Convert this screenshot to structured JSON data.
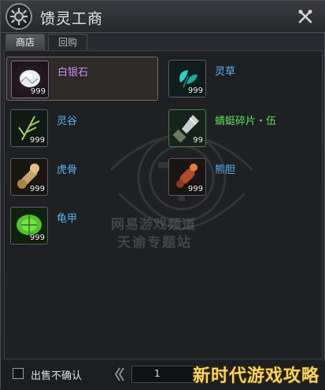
{
  "window": {
    "title": "馈灵工商"
  },
  "tabs": [
    {
      "label": "商店",
      "active": true
    },
    {
      "label": "回购",
      "active": false
    }
  ],
  "items": [
    {
      "name": "白银石",
      "qty": "999",
      "color": "#c98df2",
      "icon": "silver-stone-icon"
    },
    {
      "name": "灵草",
      "qty": "999",
      "color": "#58b0f0",
      "icon": "spirit-herb-icon"
    },
    {
      "name": "灵谷",
      "qty": "999",
      "color": "#58b0f0",
      "icon": "spirit-grain-icon"
    },
    {
      "name": "蜻蜓碎片・伍",
      "qty": "99",
      "color": "#5fe05a",
      "icon": "dragonfly-fragment-icon"
    },
    {
      "name": "虎骨",
      "qty": "999",
      "color": "#58b0f0",
      "icon": "tiger-bone-icon"
    },
    {
      "name": "熊胆",
      "qty": "999",
      "color": "#58b0f0",
      "icon": "bear-gall-icon"
    },
    {
      "name": "龟甲",
      "qty": "999",
      "color": "#58b0f0",
      "icon": "turtle-shell-icon"
    }
  ],
  "watermark": {
    "line1": "网易游戏频道",
    "line2": "天谕专题站"
  },
  "footer": {
    "checkbox_label": "出售不确认",
    "page": "1",
    "site_watermark": "新时代游戏攻略"
  }
}
